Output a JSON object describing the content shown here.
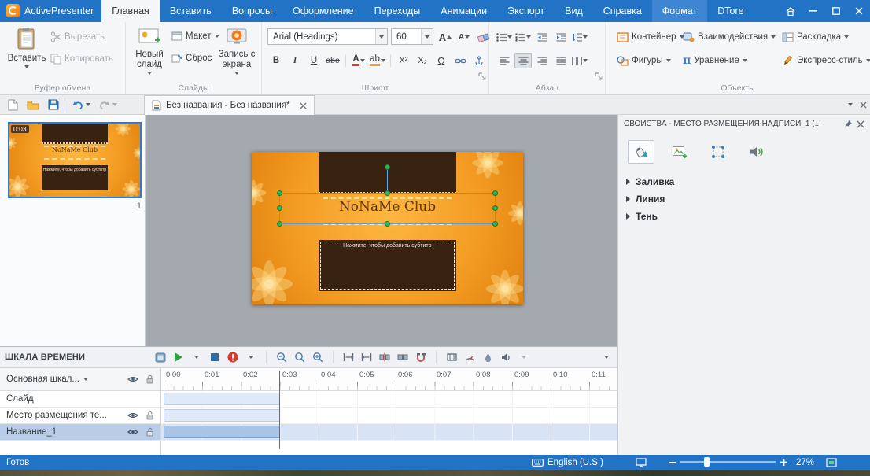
{
  "titlebar": {
    "app_name": "ActivePresenter",
    "tabs": [
      {
        "label": "Главная"
      },
      {
        "label": "Вставить"
      },
      {
        "label": "Вопросы"
      },
      {
        "label": "Оформление"
      },
      {
        "label": "Переходы"
      },
      {
        "label": "Анимации"
      },
      {
        "label": "Экспорт"
      },
      {
        "label": "Вид"
      },
      {
        "label": "Справка"
      },
      {
        "label": "Формат"
      },
      {
        "label": "DTore"
      }
    ]
  },
  "ribbon": {
    "groups": {
      "clipboard": {
        "label": "Буфер обмена",
        "paste": "Вставить",
        "cut": "Вырезать",
        "copy": "Копировать"
      },
      "slides": {
        "label": "Слайды",
        "new_slide": "Новый слайд",
        "layout": "Макет",
        "reset": "Сброс",
        "screen_record": "Запись с экрана"
      },
      "font": {
        "label": "Шрифт",
        "family_value": "Arial (Headings)",
        "size_value": "60",
        "grow": "A",
        "shrink": "A",
        "bold": "B",
        "italic": "I",
        "underline": "U",
        "strikethrough": "abe",
        "color": "A",
        "highlight": "ab",
        "superscript": "X²",
        "subscript": "X₂",
        "symbol": "Ω"
      },
      "paragraph": {
        "label": "Абзац"
      },
      "objects": {
        "label": "Объекты",
        "container": "Контейнер",
        "interactions": "Взаимодействия",
        "layout": "Раскладка",
        "shapes": "Фигуры",
        "equation": "Уравнение",
        "equation_icon": "π",
        "express_style": "Экспресс-стиль"
      }
    }
  },
  "quick_access": {
    "document_tab": "Без названия - Без названия*"
  },
  "slides_panel": {
    "thumb_duration": "0:03",
    "thumb_number": "1"
  },
  "slide": {
    "title": "NoNaMe Club",
    "subtitle_placeholder": "Нажмите, чтобы добавить субтитр"
  },
  "properties_panel": {
    "title": "СВОЙСТВА - МЕСТО РАЗМЕЩЕНИЯ НАДПИСИ_1 (...",
    "sections": [
      {
        "label": "Заливка"
      },
      {
        "label": "Линия"
      },
      {
        "label": "Тень"
      }
    ]
  },
  "timeline": {
    "title": "ШКАЛА ВРЕМЕНИ",
    "main_track_label": "Основная шкал...",
    "ruler": [
      "0:00",
      "0:01",
      "0:02",
      "0:03",
      "0:04",
      "0:05",
      "0:06",
      "0:07",
      "0:08",
      "0:09",
      "0:10",
      "0:11"
    ],
    "rows": [
      {
        "label": "Слайд"
      },
      {
        "label": "Место размещения те..."
      },
      {
        "label": "Название_1"
      }
    ]
  },
  "statusbar": {
    "ready": "Готов",
    "language": "English (U.S.)",
    "zoom": "27%"
  },
  "colors": {
    "titlebar_blue": "#2273c6",
    "accent_blue": "#2b7cd3",
    "selection_green": "#37b357",
    "record_red": "#e03a2e",
    "slide_orange": "#f49d24",
    "slide_brown": "#382312"
  }
}
